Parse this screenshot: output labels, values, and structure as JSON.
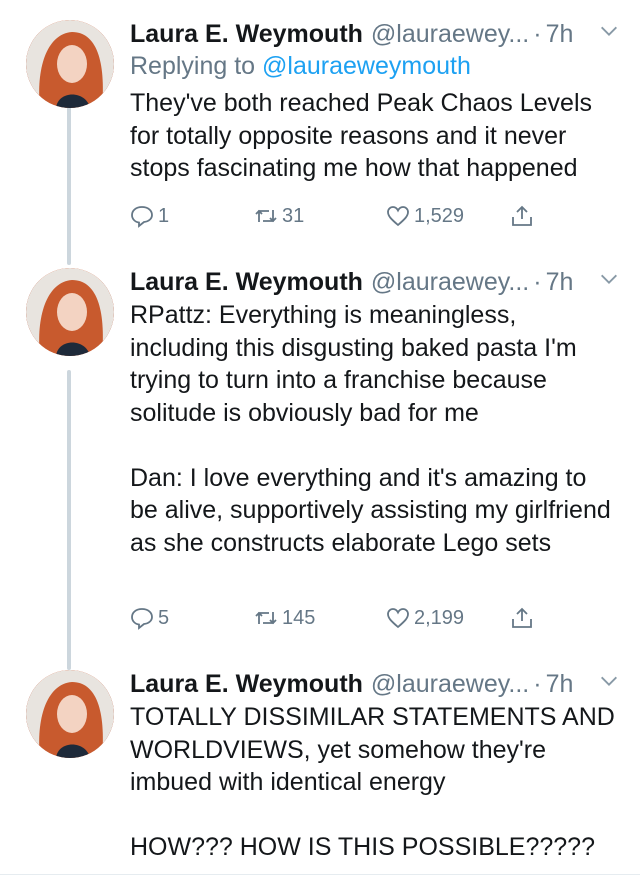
{
  "tweets": [
    {
      "name": "Laura E. Weymouth",
      "handle": "@lauraewey...",
      "dot": "·",
      "time": "7h",
      "reply_prefix": "Replying to ",
      "reply_mention": "@lauraeweymouth",
      "text": "They've both reached Peak Chaos Levels for totally opposite reasons and it never stops fascinating me how that happened",
      "replies": "1",
      "retweets": "31",
      "likes": "1,529"
    },
    {
      "name": "Laura E. Weymouth",
      "handle": "@lauraewey...",
      "dot": "·",
      "time": "7h",
      "text": "RPattz: Everything is meaningless, including this disgusting baked pasta I'm trying to turn into a franchise because solitude is obviously bad for me\n\nDan: I love everything and it's amazing to be alive, supportively assisting my girlfriend as she constructs elaborate Lego sets",
      "replies": "5",
      "retweets": "145",
      "likes": "2,199"
    },
    {
      "name": "Laura E. Weymouth",
      "handle": "@lauraewey...",
      "dot": "·",
      "time": "7h",
      "text": "TOTALLY DISSIMILAR STATEMENTS AND WORLDVIEWS, yet somehow they're imbued with identical energy\n\nHOW??? HOW IS THIS POSSIBLE?????"
    }
  ],
  "colors": {
    "text": "#14171a",
    "secondary": "#657786",
    "link": "#1da1f2",
    "thread_line": "#ccd6dd"
  },
  "icons": [
    "reply-icon",
    "retweet-icon",
    "like-icon",
    "share-icon",
    "chevron-down-icon"
  ]
}
